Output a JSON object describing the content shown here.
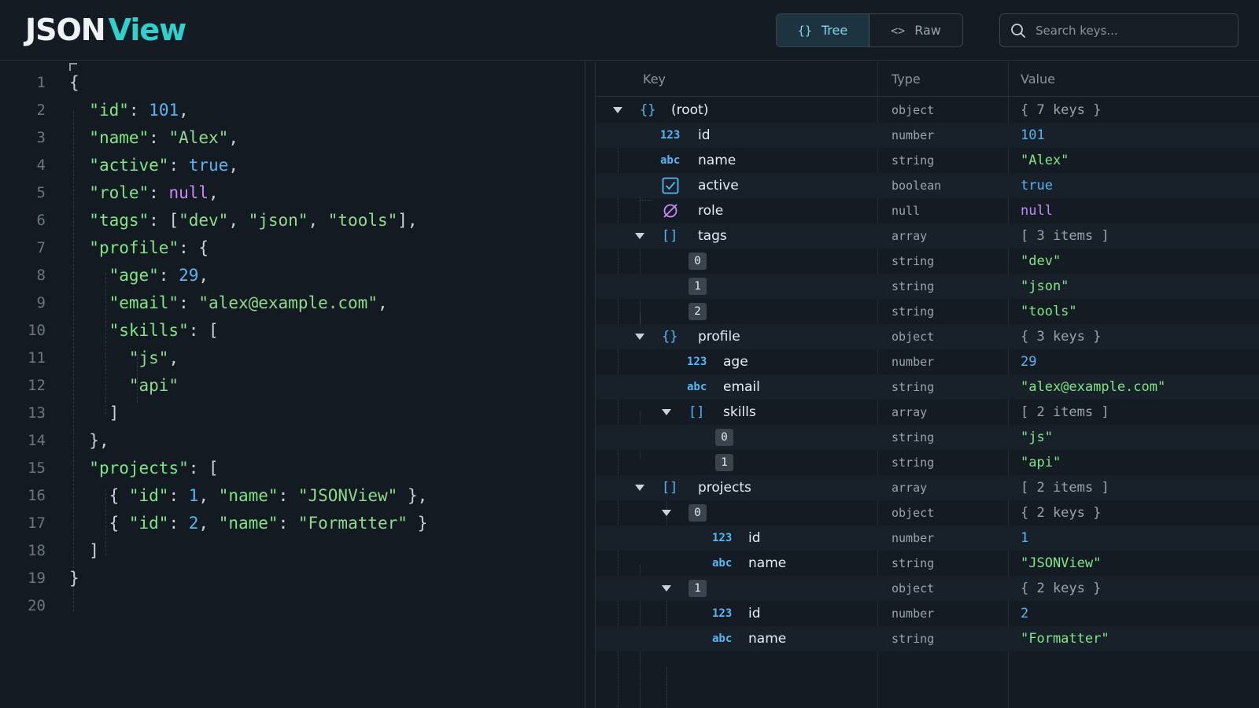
{
  "brand": {
    "part1": "JSON",
    "part2": "View"
  },
  "toolbar": {
    "tree_icon": "{}",
    "tree_label": "Tree",
    "raw_icon": "<>",
    "raw_label": "Raw",
    "search_placeholder": "Search keys..."
  },
  "editor": {
    "line_numbers": [
      "1",
      "2",
      "3",
      "4",
      "5",
      "6",
      "7",
      "8",
      "9",
      "10",
      "11",
      "12",
      "13",
      "14",
      "15",
      "16",
      "17",
      "18",
      "19",
      "20"
    ]
  },
  "tree": {
    "columns": {
      "key": "Key",
      "type": "Type",
      "value": "Value"
    },
    "rows": [
      {
        "key": "(root)",
        "type": "object",
        "value": "{ 7 keys }"
      },
      {
        "key": "id",
        "type": "number",
        "value": "101"
      },
      {
        "key": "name",
        "type": "string",
        "value": "\"Alex\""
      },
      {
        "key": "active",
        "type": "boolean",
        "value": "true"
      },
      {
        "key": "role",
        "type": "null",
        "value": "null"
      },
      {
        "key": "tags",
        "type": "array",
        "value": "[ 3 items ]"
      },
      {
        "key": "0",
        "type": "string",
        "value": "\"dev\""
      },
      {
        "key": "1",
        "type": "string",
        "value": "\"json\""
      },
      {
        "key": "2",
        "type": "string",
        "value": "\"tools\""
      },
      {
        "key": "profile",
        "type": "object",
        "value": "{ 3 keys }"
      },
      {
        "key": "age",
        "type": "number",
        "value": "29"
      },
      {
        "key": "email",
        "type": "string",
        "value": "\"alex@example.com\""
      },
      {
        "key": "skills",
        "type": "array",
        "value": "[ 2 items ]"
      },
      {
        "key": "0",
        "type": "string",
        "value": "\"js\""
      },
      {
        "key": "1",
        "type": "string",
        "value": "\"api\""
      },
      {
        "key": "projects",
        "type": "array",
        "value": "[ 2 items ]"
      },
      {
        "key": "0",
        "type": "object",
        "value": "{ 2 keys }"
      },
      {
        "key": "id",
        "type": "number",
        "value": "1"
      },
      {
        "key": "name",
        "type": "string",
        "value": "\"JSONView\""
      },
      {
        "key": "1",
        "type": "object",
        "value": "{ 2 keys }"
      },
      {
        "key": "id",
        "type": "number",
        "value": "2"
      },
      {
        "key": "name",
        "type": "string",
        "value": "\"Formatter\""
      }
    ],
    "icons": {
      "object": "{}",
      "array": "[]",
      "number": "123",
      "string": "abc"
    }
  },
  "colors": {
    "accent": "#2fd1cf",
    "string": "#7ee787",
    "number": "#58b6f5",
    "null": "#c58af9",
    "background": "#151b23"
  }
}
